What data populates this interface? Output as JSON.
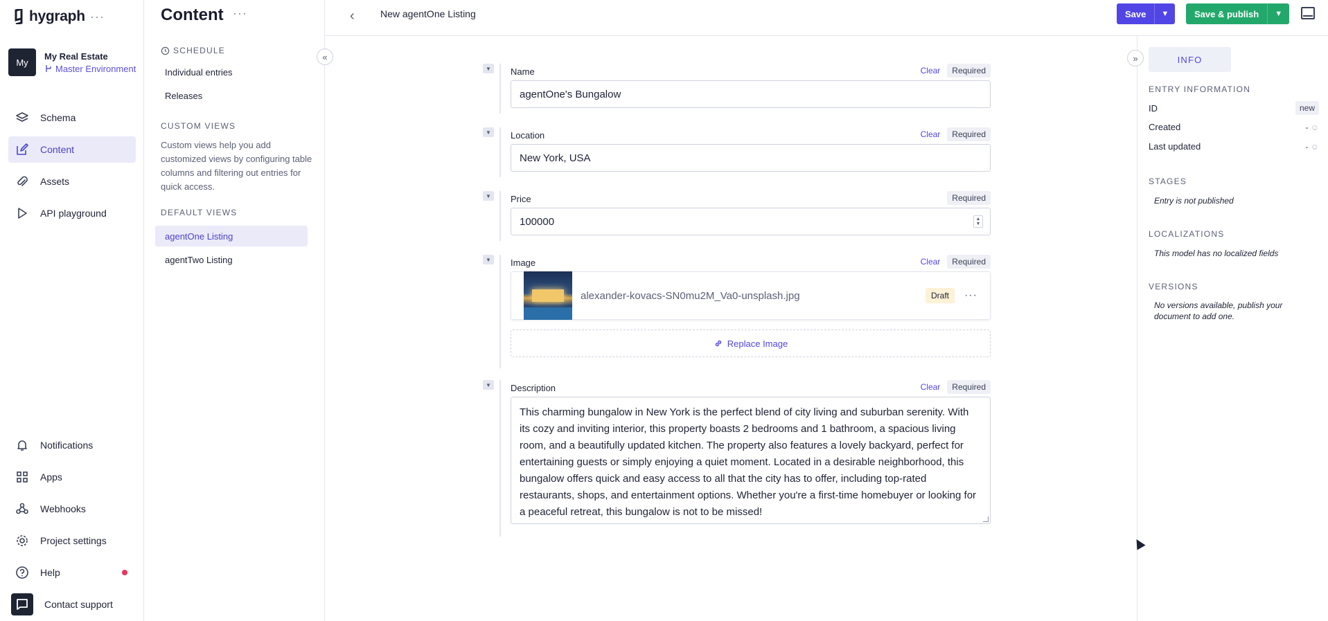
{
  "brand": {
    "name": "hygraph",
    "menu_glyph": "···"
  },
  "project": {
    "avatar": "My",
    "name": "My Real Estate",
    "environment": "Master Environment"
  },
  "nav": {
    "schema": "Schema",
    "content": "Content",
    "assets": "Assets",
    "api_playground": "API playground",
    "notifications": "Notifications",
    "apps": "Apps",
    "webhooks": "Webhooks",
    "project_settings": "Project settings",
    "help": "Help",
    "contact_support": "Contact support"
  },
  "content_sidebar": {
    "title": "Content",
    "menu_glyph": "···",
    "schedule_heading": "SCHEDULE",
    "individual_entries": "Individual entries",
    "releases": "Releases",
    "custom_views_heading": "CUSTOM VIEWS",
    "custom_views_desc": "Custom views help you add customized views by configuring table columns and filtering out entries for quick access.",
    "default_views_heading": "DEFAULT VIEWS",
    "views": [
      "agentOne Listing",
      "agentTwo Listing"
    ]
  },
  "header": {
    "title": "New agentOne Listing",
    "save": "Save",
    "save_publish": "Save & publish"
  },
  "form": {
    "clear_label": "Clear",
    "required_label": "Required",
    "name": {
      "label": "Name",
      "value": "agentOne's Bungalow"
    },
    "location": {
      "label": "Location",
      "value": "New York, USA"
    },
    "price": {
      "label": "Price",
      "value": "100000"
    },
    "image": {
      "label": "Image",
      "filename": "alexander-kovacs-SN0mu2M_Va0-unsplash.jpg",
      "status": "Draft",
      "more": "···",
      "replace": "Replace Image"
    },
    "description": {
      "label": "Description",
      "value": "This charming bungalow in New York is the perfect blend of city living and suburban serenity. With its cozy and inviting interior, this property boasts 2 bedrooms and 1 bathroom, a spacious living room, and a beautifully updated kitchen. The property also features a lovely backyard, perfect for entertaining guests or simply enjoying a quiet moment. Located in a desirable neighborhood, this bungalow offers quick and easy access to all that the city has to offer, including top-rated restaurants, shops, and entertainment options. Whether you're a first-time homebuyer or looking for a peaceful retreat, this bungalow is not to be missed!"
    }
  },
  "info_panel": {
    "tab": "INFO",
    "entry_info_heading": "ENTRY INFORMATION",
    "id_label": "ID",
    "id_value": "new",
    "created_label": "Created",
    "created_value": "-",
    "updated_label": "Last updated",
    "updated_value": "-",
    "stages_heading": "STAGES",
    "stages_note": "Entry is not published",
    "localizations_heading": "LOCALIZATIONS",
    "localizations_note": "This model has no localized fields",
    "versions_heading": "VERSIONS",
    "versions_note": "No versions available, publish your document to add one."
  },
  "colors": {
    "accent": "#5146e5",
    "publish": "#23a86b",
    "nav_dark": "#1f2433"
  }
}
